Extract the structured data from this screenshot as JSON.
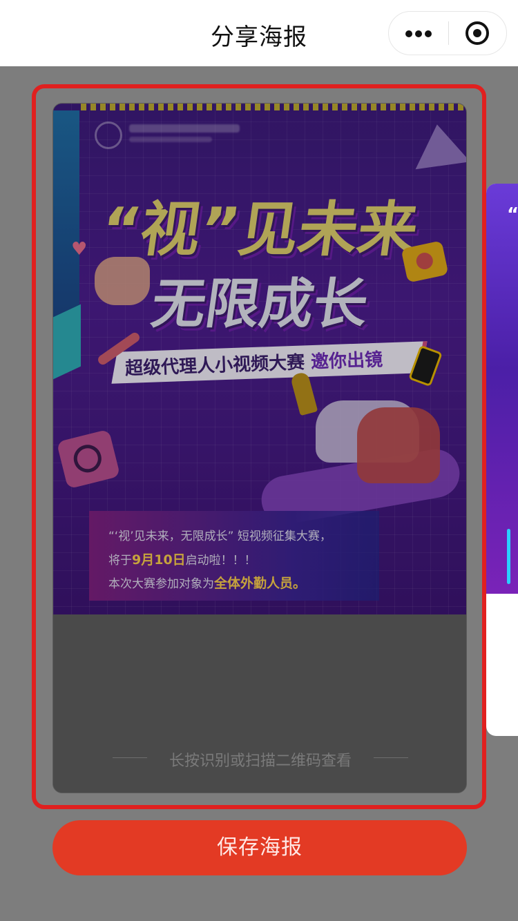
{
  "navbar": {
    "title": "分享海报",
    "more_icon": "more-dots-icon",
    "close_icon": "close-target-icon"
  },
  "poster": {
    "title_line1": "“视”见未来",
    "title_line2": "无限成长",
    "banner_main": "超级代理人小视频大赛",
    "banner_invite": "邀你出镜",
    "info": {
      "line1": "“‘视’见未来，无限成长” 短视频征集大赛，",
      "line2_prefix": "将于",
      "line2_date": "9月10日",
      "line2_suffix": "启动啦！！！",
      "line3_prefix": "本次大赛参加对象为",
      "line3_target": "全体外勤人员。"
    },
    "qr_hint": "长按识别或扫描二维码查看"
  },
  "actions": {
    "save_label": "保存海报"
  },
  "colors": {
    "accent": "#e33a24",
    "frame": "#e0201f",
    "background": "#7d7d7d"
  }
}
